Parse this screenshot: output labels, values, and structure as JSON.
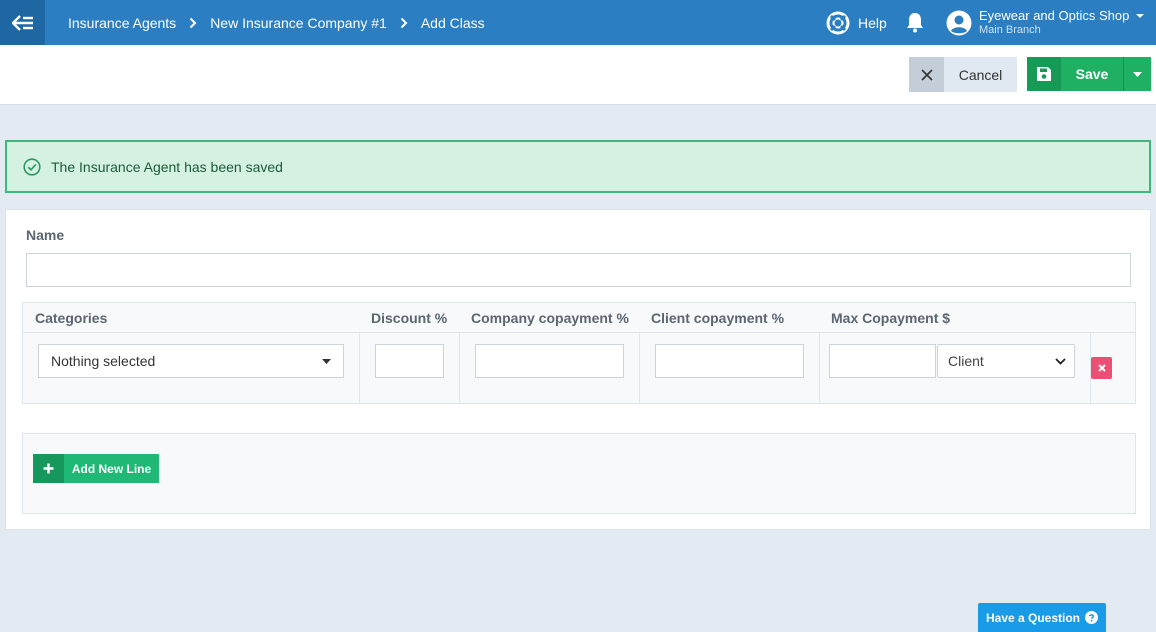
{
  "header": {
    "breadcrumbs": [
      "Insurance Agents",
      "New Insurance Company #1",
      "Add Class"
    ],
    "help_label": "Help",
    "account_name": "Eyewear and Optics Shop",
    "branch_name": "Main Branch"
  },
  "toolbar": {
    "cancel_label": "Cancel",
    "save_label": "Save"
  },
  "alert": {
    "message": "The Insurance Agent has been saved"
  },
  "form": {
    "name_label": "Name",
    "name_value": "",
    "columns": [
      "Categories",
      "Discount %",
      "Company copayment %",
      "Client copayment %",
      "Max Copayment $"
    ],
    "row": {
      "categories_value": "Nothing selected",
      "discount_value": "",
      "company_copayment_value": "",
      "client_copayment_value": "",
      "max_copayment_value": "",
      "payer_value": "Client"
    },
    "add_line_label": "Add New Line"
  },
  "help_widget": {
    "label": "Have a Question"
  },
  "colors": {
    "topbar": "#2a7ec1",
    "save": "#1fb064",
    "alert_border": "#3bb87a",
    "delete": "#ec4f74",
    "question": "#1a9be8"
  }
}
